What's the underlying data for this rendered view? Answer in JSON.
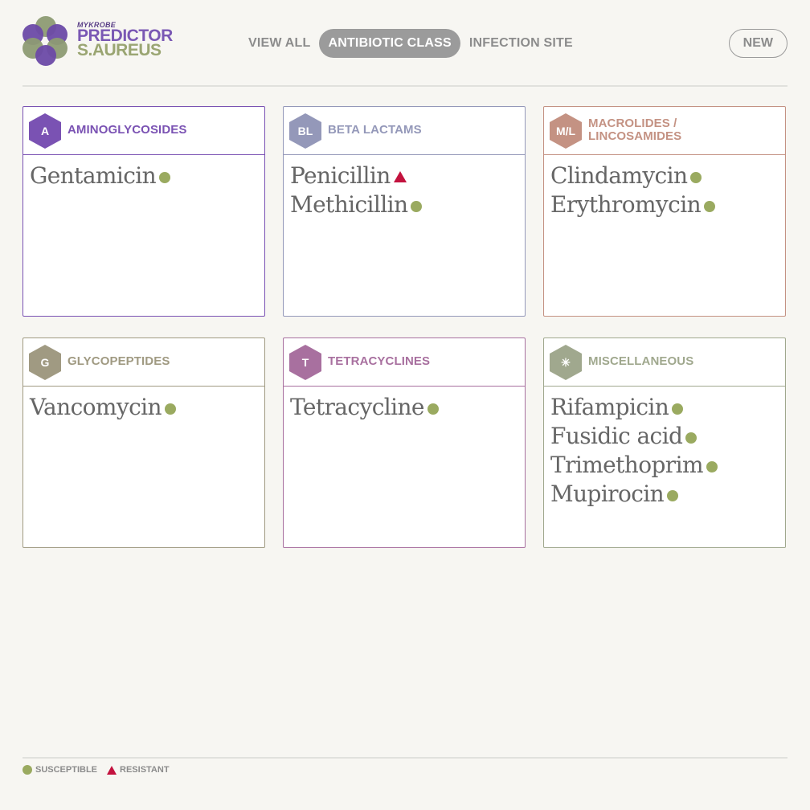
{
  "logo": {
    "small": "MYKROBE",
    "big": "PREDICTOR",
    "sub": "S.AUREUS"
  },
  "nav": {
    "items": [
      {
        "label": "VIEW ALL",
        "active": false
      },
      {
        "label": "ANTIBIOTIC CLASS",
        "active": true
      },
      {
        "label": "INFECTION SITE",
        "active": false
      }
    ],
    "new_label": "NEW"
  },
  "colors": {
    "susceptible": "#9aaa60",
    "resistant": "#c3123e"
  },
  "cards": [
    {
      "abbr": "A",
      "title": "AMINOGLYCOSIDES",
      "color": "#7a52b3",
      "drugs": [
        {
          "name": "Gentamicin",
          "status": "susceptible"
        }
      ]
    },
    {
      "abbr": "BL",
      "title": "BETA LACTAMS",
      "color": "#9498b9",
      "drugs": [
        {
          "name": "Penicillin",
          "status": "resistant"
        },
        {
          "name": "Methicillin",
          "status": "susceptible"
        }
      ]
    },
    {
      "abbr": "M/L",
      "title": "MACROLIDES / LINCOSAMIDES",
      "color": "#c49283",
      "drugs": [
        {
          "name": "Clindamycin",
          "status": "susceptible"
        },
        {
          "name": "Erythromycin",
          "status": "susceptible"
        }
      ]
    },
    {
      "abbr": "G",
      "title": "GLYCOPEPTIDES",
      "color": "#a09a82",
      "drugs": [
        {
          "name": "Vancomycin",
          "status": "susceptible"
        }
      ]
    },
    {
      "abbr": "T",
      "title": "TETRACYCLINES",
      "color": "#a8709f",
      "drugs": [
        {
          "name": "Tetracycline",
          "status": "susceptible"
        }
      ]
    },
    {
      "abbr": "✳",
      "title": "MISCELLANEOUS",
      "color": "#a0a88e",
      "drugs": [
        {
          "name": "Rifampicin",
          "status": "susceptible"
        },
        {
          "name": "Fusidic acid",
          "status": "susceptible"
        },
        {
          "name": "Trimethoprim",
          "status": "susceptible"
        },
        {
          "name": "Mupirocin",
          "status": "susceptible"
        }
      ]
    }
  ],
  "legend": {
    "susceptible": "SUSCEPTIBLE",
    "resistant": "RESISTANT"
  }
}
